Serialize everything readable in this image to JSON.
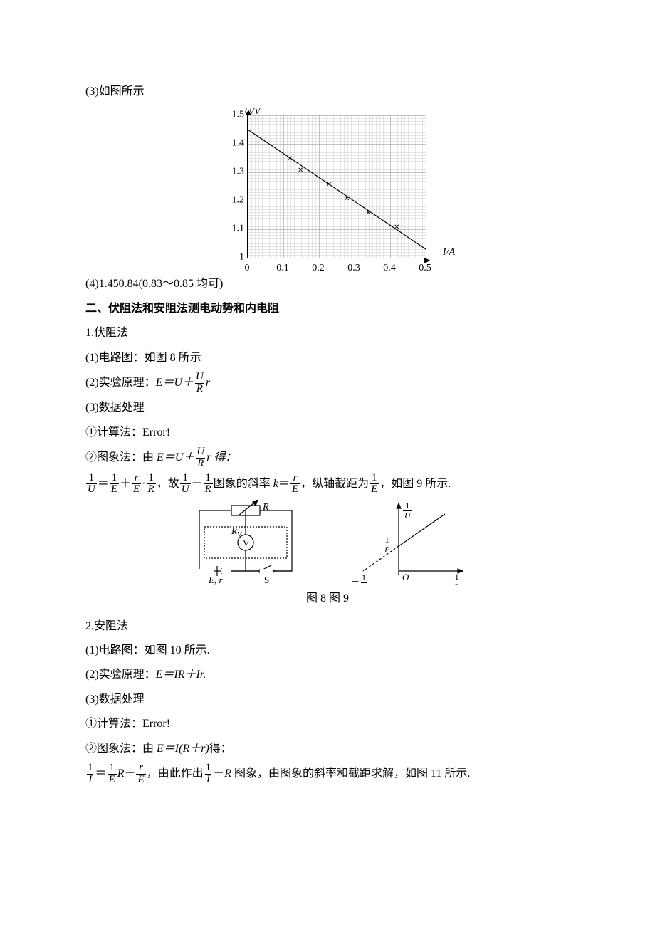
{
  "p3_label": "(3)如图所示",
  "chart_data": {
    "type": "scatter",
    "xlabel": "I/A",
    "ylabel": "U/V",
    "xlim": [
      0,
      0.5
    ],
    "ylim": [
      1.0,
      1.5
    ],
    "xticks": [
      0,
      0.1,
      0.2,
      0.3,
      0.4,
      0.5
    ],
    "yticks": [
      1.0,
      1.1,
      1.2,
      1.3,
      1.4,
      1.5
    ],
    "points": [
      {
        "x": 0.12,
        "y": 1.34
      },
      {
        "x": 0.15,
        "y": 1.3
      },
      {
        "x": 0.23,
        "y": 1.25
      },
      {
        "x": 0.28,
        "y": 1.2
      },
      {
        "x": 0.34,
        "y": 1.15
      },
      {
        "x": 0.42,
        "y": 1.1
      }
    ],
    "fit_line": {
      "x1": 0,
      "y1": 1.45,
      "x2": 0.5,
      "y2": 1.03
    }
  },
  "p4_prefix": "(4)",
  "p4_value": "1.450.84(0.83～0.85 均可)",
  "sec2_title": "二、伏阻法和安阻法测电动势和内电阻",
  "m1_title": "1.伏阻法",
  "m1_1": "(1)电路图：如图 8 所示",
  "m1_2_a": "(2)实验原理：",
  "m1_2_eq_lhs": "E＝U＋",
  "m1_2_num": "U",
  "m1_2_den": "R",
  "m1_2_tail": "r",
  "m1_3": "(3)数据处理",
  "m1_calc": "①计算法：Error!",
  "m1_graph_a": "②图象法：由 ",
  "m1_graph_eq_lhs": "E＝U＋",
  "m1_graph_num": "U",
  "m1_graph_den": "R",
  "m1_graph_tail": "r 得：",
  "m1_eqline": {
    "f1n": "1",
    "f1d": "U",
    "eq": "＝",
    "f2n": "1",
    "f2d": "E",
    "plus": "＋",
    "f3n": "r",
    "f3d": "E",
    "dot": "·",
    "f4n": "1",
    "f4d": "R",
    "t1": "，故",
    "f5n": "1",
    "f5d": "U",
    "dash": "－",
    "f6n": "1",
    "f6d": "R",
    "t2": "图象的斜率 ",
    "kvar": "k",
    "t2b": "＝",
    "f7n": "r",
    "f7d": "E",
    "t3": "，纵轴截距为",
    "f8n": "1",
    "f8d": "E",
    "t4": "，如图 9 所示."
  },
  "circuit": {
    "R": "R",
    "Rv": "R",
    "Rv_sub": "V",
    "V": "V",
    "Er": "E, r",
    "S": "S"
  },
  "graph9": {
    "yl_n": "1",
    "yl_d": "U",
    "yint_n": "1",
    "yint_d": "E",
    "xl_n": "1",
    "xl_d": "R",
    "xint": "－",
    "xint_n": "1",
    "xint_d": "r",
    "O": "O"
  },
  "caption89": "图 8 图 9",
  "m2_title": "2.安阻法",
  "m2_1": "(1)电路图：如图 10 所示.",
  "m2_2_a": "(2)实验原理：",
  "m2_2_eq": "E＝IR＋Ir.",
  "m2_3": "(3)数据处理",
  "m2_calc": "①计算法：Error!",
  "m2_graph_a": "②图象法：由 ",
  "m2_graph_eq": "E＝I(R＋r)",
  "m2_graph_b": "得：",
  "m2_eqline": {
    "f1n": "1",
    "f1d": "I",
    "eq": "＝",
    "f2n": "1",
    "f2d": "E",
    "R": "R",
    "plus": "＋",
    "f3n": "r",
    "f3d": "E",
    "t1": "，由此作出",
    "f4n": "1",
    "f4d": "I",
    "dash": "－",
    "R2": "R",
    "t2": " 图象，由图象的斜率和截距求解，如图 11 所示."
  }
}
